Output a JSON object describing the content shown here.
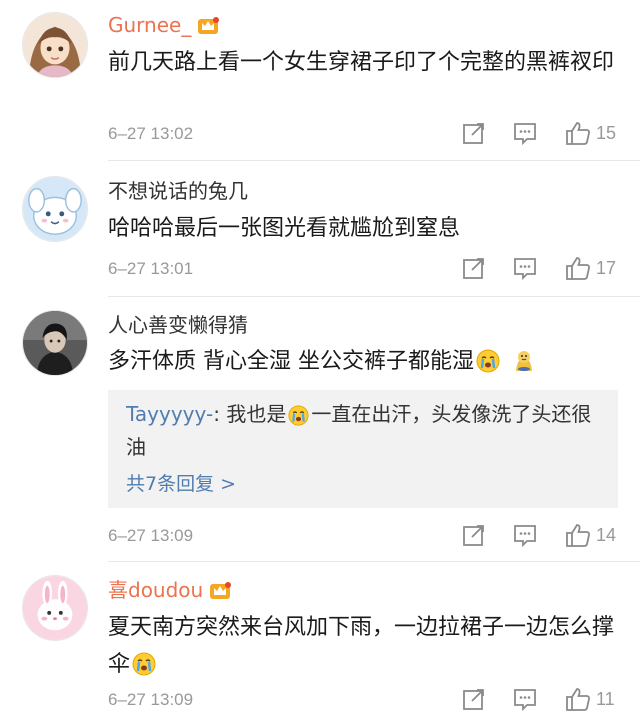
{
  "comments": [
    {
      "username": "Gurnee_",
      "text": "前几天路上看一个女生穿裙子印了个完整的黑裤衩印",
      "time": "6–27 13:02",
      "likes": "15"
    },
    {
      "username": "不想说话的兔几",
      "text": "哈哈哈最后一张图光看就尴尬到窒息",
      "time": "6–27 13:01",
      "likes": "17"
    },
    {
      "username": "人心善变懒得猜",
      "text": "多汗体质 背心全湿 坐公交裤子都能湿",
      "time": "6–27 13:09",
      "likes": "14",
      "reply": {
        "user": "Tayyyyy-",
        "text_before": ": 我也是",
        "text_after": "一直在出汗，头发像洗了头还很油",
        "more": "共7条回复 >"
      }
    },
    {
      "username": "喜doudou",
      "text": "夏天南方突然来台风加下雨，一边拉裙子一边怎么撑伞",
      "time": "6–27 13:09",
      "likes": "11"
    }
  ],
  "icons": {
    "share": "share-icon",
    "comment": "comment-icon",
    "like": "thumbs-up-icon",
    "vip": "vip-crown-badge",
    "crying": "crying-face-emoji",
    "doge": "doge-emoji"
  },
  "colors": {
    "vip_username": "#eb7350",
    "username": "#333333",
    "link": "#507daf",
    "meta": "#999999"
  }
}
